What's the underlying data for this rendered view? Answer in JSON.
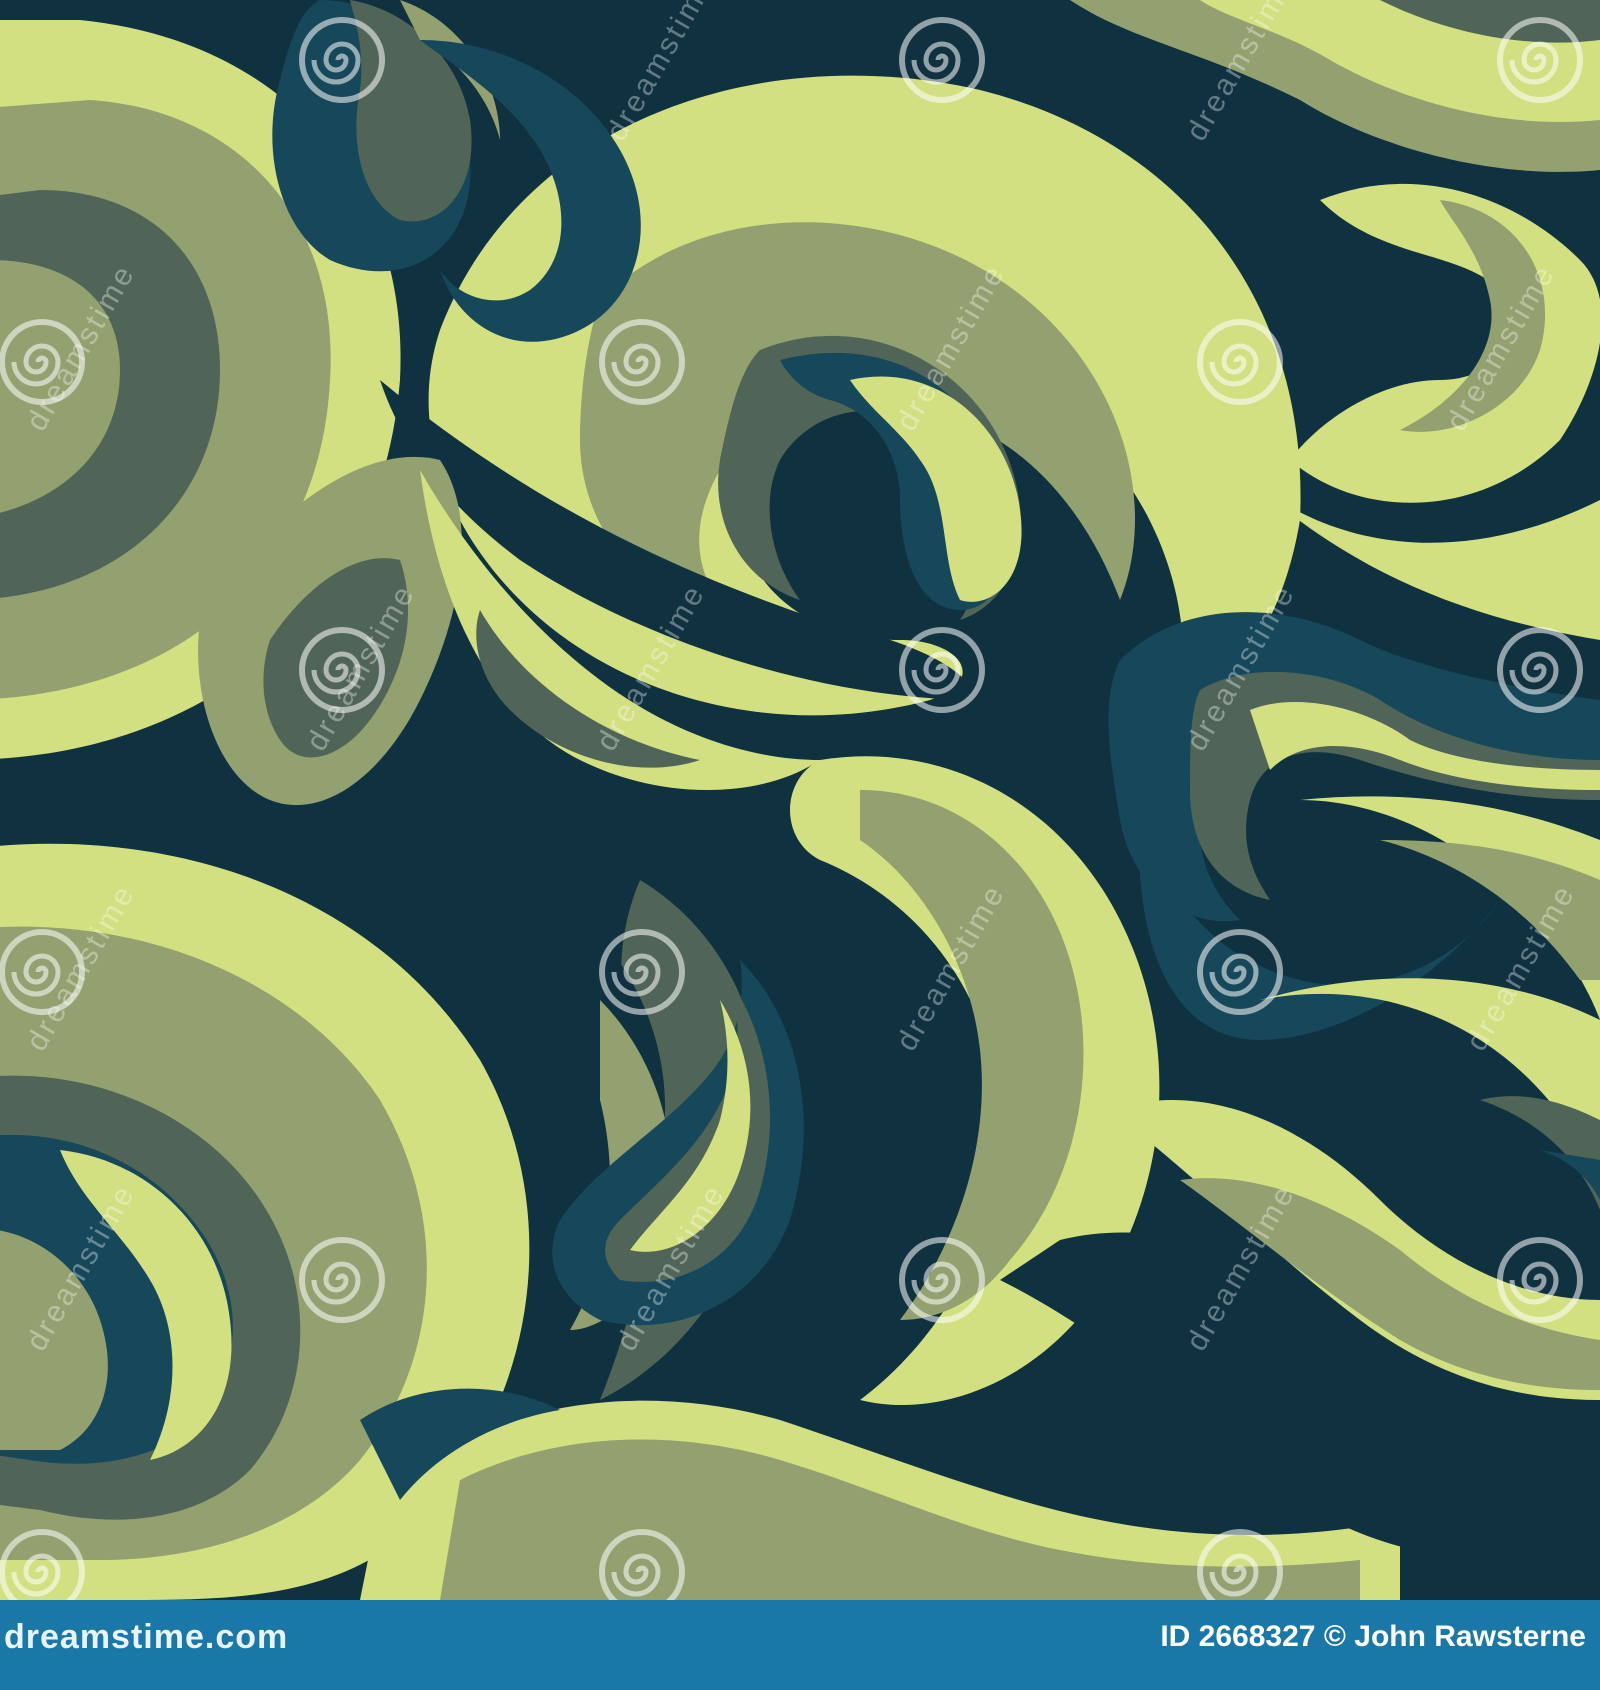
{
  "palette": {
    "background_dark": "#0f3140",
    "teal": "#16475a",
    "slate": "#506558",
    "olive": "#7f8f62",
    "sage": "#93a070",
    "lime": "#d3e081",
    "footer_blue": "#1a78a8"
  },
  "watermark": {
    "text": "dreamstime",
    "icon": "spiral-logo-icon"
  },
  "footer": {
    "logo_text": "dreamstime.com",
    "image_id": "ID 2668327",
    "copyright_symbol": "©",
    "author": "John Rawsterne"
  }
}
